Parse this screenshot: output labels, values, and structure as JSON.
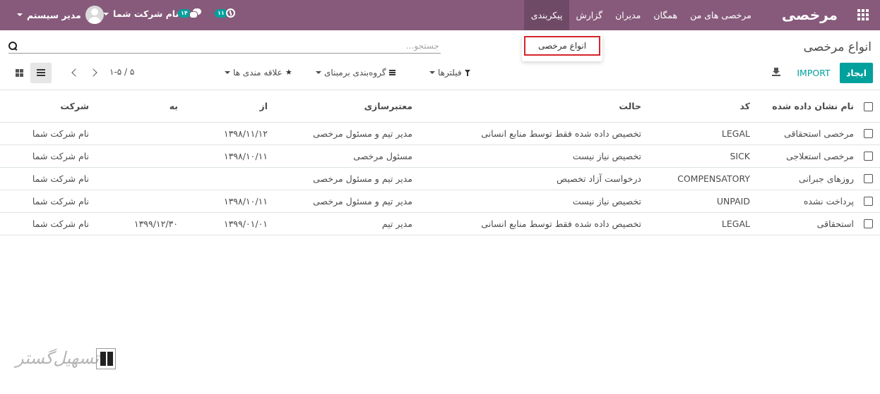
{
  "navbar": {
    "brand": "مرخصی",
    "menu": [
      {
        "label": "مرخصی های من"
      },
      {
        "label": "همگان"
      },
      {
        "label": "مدیران"
      },
      {
        "label": "گزارش"
      },
      {
        "label": "پیکربندی"
      }
    ],
    "user_name": "مدیر سیستم",
    "company_name": "نام شرکت شما",
    "messages_count": "۱۴",
    "activities_count": "۱۱"
  },
  "dropdown": {
    "item_label": "انواع مرخصی"
  },
  "control_panel": {
    "title": "انواع مرخصی",
    "search_placeholder": "جستجو...",
    "create_label": "ایجاد",
    "import_label": "IMPORT",
    "filters_label": "فیلترها",
    "groupby_label": "گروه‌بندی برمبنای",
    "favorites_label": "علاقه مندی ها",
    "pager": "۱-۵ / ۵"
  },
  "table": {
    "headers": {
      "name": "نام نشان داده شده",
      "code": "کد",
      "state": "حالت",
      "validation": "معتبرسازی",
      "from": "از",
      "to": "به",
      "company": "شرکت"
    },
    "rows": [
      {
        "name": "مرخصی استحقاقی",
        "code": "LEGAL",
        "state": "تخصیص داده شده فقط توسط منابع انسانی",
        "validation": "مدیر تیم و مسئول مرخصی",
        "from": "۱۳۹۸/۱۱/۱۲",
        "to": "",
        "company": "نام شرکت شما"
      },
      {
        "name": "مرخصی استعلاجی",
        "code": "SICK",
        "state": "تخصیص نیاز نیست",
        "validation": "مسئول مرخصی",
        "from": "۱۳۹۸/۱۰/۱۱",
        "to": "",
        "company": "نام شرکت شما"
      },
      {
        "name": "روزهای جبرانی",
        "code": "COMPENSATORY",
        "state": "درخواست آزاد تخصیص",
        "validation": "مدیر تیم و مسئول مرخصی",
        "from": "",
        "to": "",
        "company": "نام شرکت شما"
      },
      {
        "name": "پرداخت نشده",
        "code": "UNPAID",
        "state": "تخصیص نیاز نیست",
        "validation": "مدیر تیم و مسئول مرخصی",
        "from": "۱۳۹۸/۱۰/۱۱",
        "to": "",
        "company": "نام شرکت شما"
      },
      {
        "name": "استحقاقی",
        "code": "LEGAL",
        "state": "تخصیص داده شده فقط توسط منابع انسانی",
        "validation": "مدیر تیم",
        "from": "۱۳۹۹/۰۱/۰۱",
        "to": "۱۳۹۹/۱۲/۳۰",
        "company": "نام شرکت شما"
      }
    ]
  },
  "watermark": {
    "text": "تسهیل‌گستر"
  },
  "colors": {
    "navbar": "#875a7b",
    "navbar_active": "#6f4a66",
    "accent": "#00a09d",
    "highlight_border": "#d5242b"
  },
  "icons": [
    "apps-grid-icon",
    "chat-icon",
    "clock-icon",
    "caret-down-icon",
    "search-icon",
    "download-icon",
    "filter-icon",
    "bars-icon",
    "star-icon",
    "chevron-left-icon",
    "chevron-right-icon",
    "list-view-icon",
    "kanban-view-icon"
  ]
}
